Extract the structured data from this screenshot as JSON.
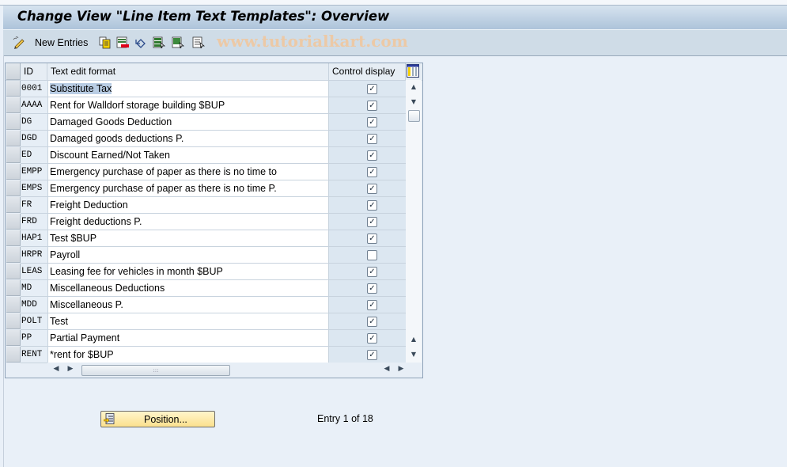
{
  "window": {
    "title": "Change View \"Line Item Text Templates\": Overview"
  },
  "toolbar": {
    "new_entries_label": "New Entries",
    "icons": [
      "edit-pencil-icon",
      "copy-icon",
      "delete-icon",
      "undo-icon",
      "select-all-icon",
      "select-block-icon",
      "deselect-all-icon"
    ],
    "watermark": "www.tutorialkart.com"
  },
  "table": {
    "columns": [
      "ID",
      "Text edit format",
      "Control display"
    ],
    "rows": [
      {
        "id": "0001",
        "text": "Substitute Tax",
        "control_display": true,
        "selected": true
      },
      {
        "id": "AAAA",
        "text": "Rent for Walldorf storage building $BUP",
        "control_display": true
      },
      {
        "id": "DG",
        "text": "Damaged Goods Deduction",
        "control_display": true
      },
      {
        "id": "DGD",
        "text": "Damaged goods deductions P.",
        "control_display": true
      },
      {
        "id": "ED",
        "text": "Discount Earned/Not Taken",
        "control_display": true
      },
      {
        "id": "EMPP",
        "text": "Emergency purchase of paper as there is no time to",
        "control_display": true
      },
      {
        "id": "EMPS",
        "text": "Emergency purchase of paper as there is no time P.",
        "control_display": true
      },
      {
        "id": "FR",
        "text": "Freight Deduction",
        "control_display": true
      },
      {
        "id": "FRD",
        "text": "Freight deductions P.",
        "control_display": true
      },
      {
        "id": "HAP1",
        "text": "Test $BUP",
        "control_display": true
      },
      {
        "id": "HRPR",
        "text": "Payroll",
        "control_display": false
      },
      {
        "id": "LEAS",
        "text": "Leasing fee for vehicles in month $BUP",
        "control_display": true
      },
      {
        "id": "MD",
        "text": "Miscellaneous Deductions",
        "control_display": true
      },
      {
        "id": "MDD",
        "text": "Miscellaneous P.",
        "control_display": true
      },
      {
        "id": "POLT",
        "text": "Test",
        "control_display": true
      },
      {
        "id": "PP",
        "text": "Partial Payment",
        "control_display": true
      },
      {
        "id": "RENT",
        "text": "*rent for $BUP",
        "control_display": true
      }
    ],
    "check_glyph": "✓",
    "hscroll_grip": ":::"
  },
  "footer": {
    "position_button_label": "Position...",
    "entry_status": "Entry 1 of 18"
  },
  "colors": {
    "title_gradient_top": "#d6e3ef",
    "title_gradient_bottom": "#adc3da",
    "toolbar_bg": "#cfdce7",
    "page_bg": "#e9f0f8",
    "position_button": "#fbe08d",
    "selection_highlight": "#b9cde4"
  }
}
